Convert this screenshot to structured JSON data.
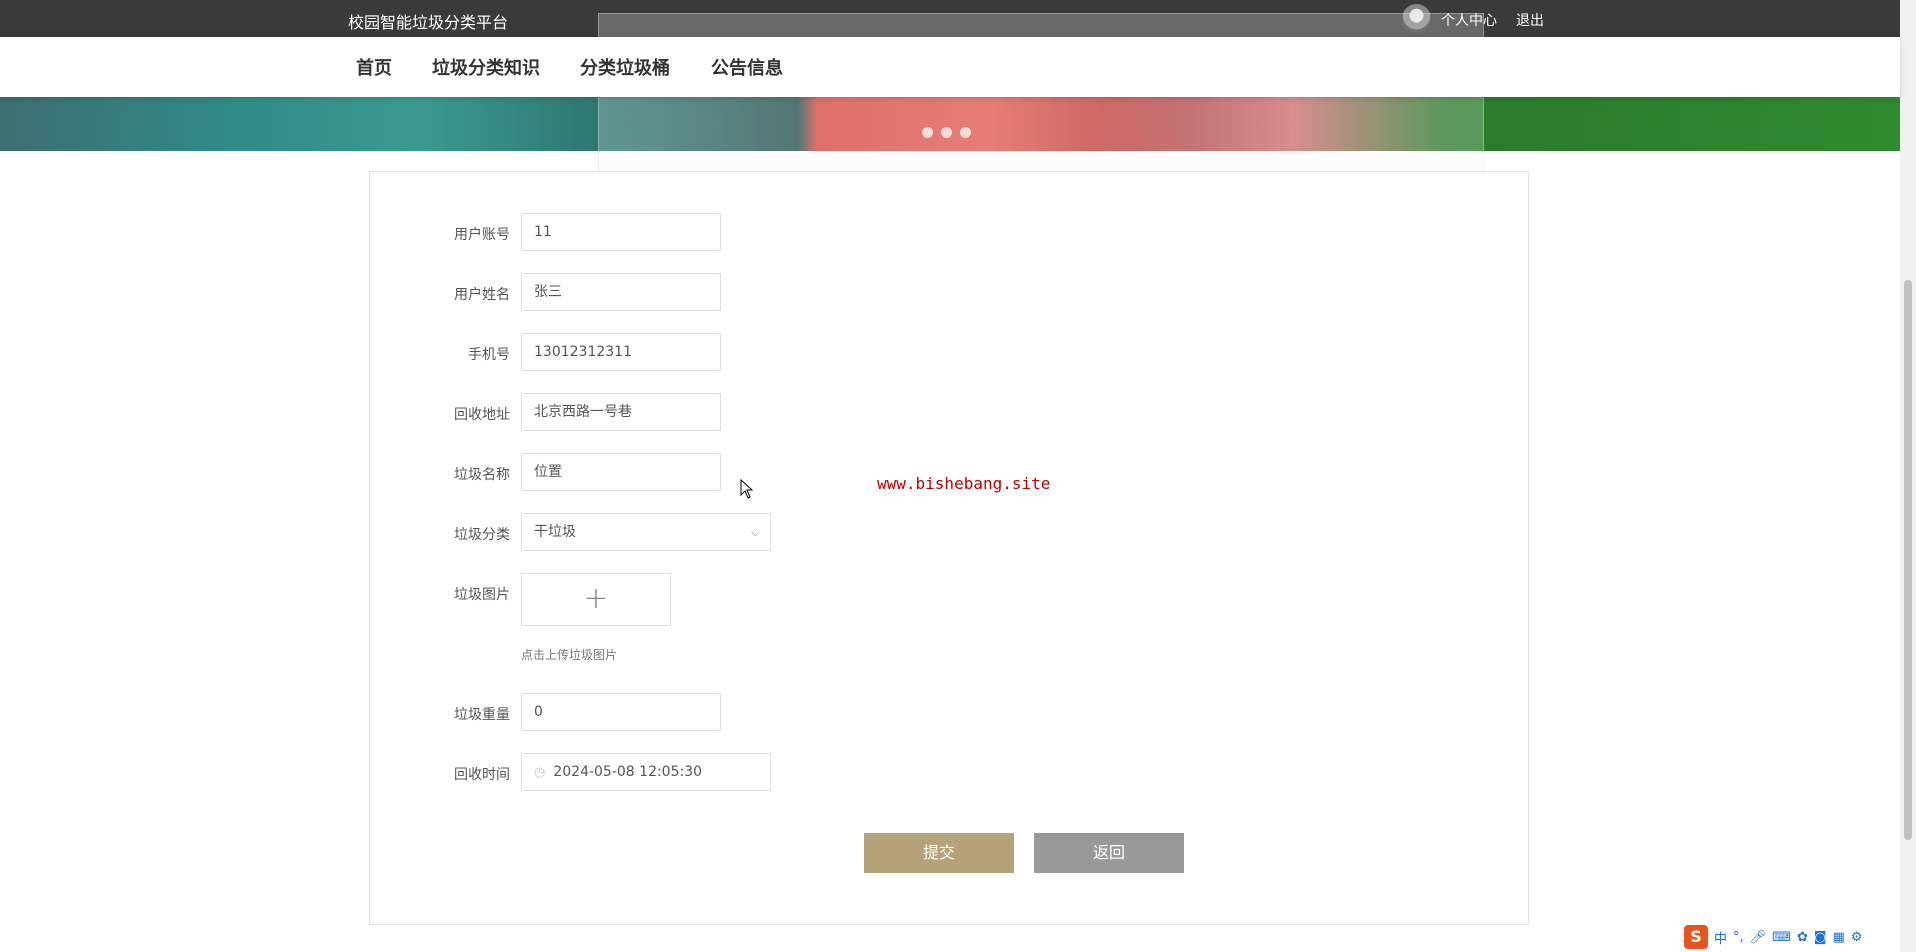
{
  "header": {
    "site_title": "校园智能垃圾分类平台",
    "personal_center": "个人中心",
    "logout": "退出"
  },
  "nav": {
    "items": [
      "首页",
      "垃圾分类知识",
      "分类垃圾桶",
      "公告信息"
    ]
  },
  "form": {
    "account": {
      "label": "用户账号",
      "value": "11"
    },
    "name": {
      "label": "用户姓名",
      "value": "张三"
    },
    "phone": {
      "label": "手机号",
      "value": "13012312311"
    },
    "address": {
      "label": "回收地址",
      "value": "北京西路一号巷"
    },
    "garbage_name": {
      "label": "垃圾名称",
      "value": "位置"
    },
    "garbage_category": {
      "label": "垃圾分类",
      "value": "干垃圾"
    },
    "garbage_image": {
      "label": "垃圾图片",
      "upload_symbol": "+",
      "hint": "点击上传垃圾图片"
    },
    "garbage_weight": {
      "label": "垃圾重量",
      "value": "0"
    },
    "recycle_time": {
      "label": "回收时间",
      "value": "2024-05-08 12:05:30"
    }
  },
  "buttons": {
    "submit": "提交",
    "back": "返回"
  },
  "watermark": "www.bishebang.site",
  "ime": {
    "logo": "S",
    "mode": "中"
  },
  "colors": {
    "topbar": "#3a3a3a",
    "submit": "#b5a278",
    "back": "#999999",
    "watermark": "#c00000"
  },
  "icons": [
    "avatar",
    "chevron-down-icon",
    "clock-icon",
    "plus-icon",
    "cursor-icon",
    "ime-logo-icon"
  ]
}
